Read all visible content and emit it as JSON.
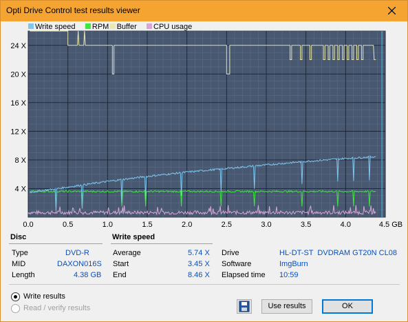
{
  "window": {
    "title": "Opti Drive Control test results viewer"
  },
  "legend": [
    {
      "label": "Write speed",
      "color": "#7ec8f0"
    },
    {
      "label": "RPM",
      "color": "#3ee63e"
    },
    {
      "label": "Buffer",
      "color": "#e8e8b0"
    },
    {
      "label": "CPU usage",
      "color": "#d7a6d7"
    }
  ],
  "chart_data": {
    "type": "line",
    "y_ticks": [
      "24 X",
      "20 X",
      "16 X",
      "12 X",
      "8 X",
      "4 X"
    ],
    "x_ticks": [
      "0.0",
      "0.5",
      "1.0",
      "1.5",
      "2.0",
      "2.5",
      "3.0",
      "3.5",
      "4.0",
      "4.5 GB"
    ],
    "xlim": [
      0,
      4.5
    ],
    "ylim": [
      0,
      26
    ],
    "series": [
      {
        "name": "Write speed",
        "x": [
          0,
          0.5,
          1.0,
          1.5,
          2.0,
          2.5,
          3.0,
          3.5,
          4.0,
          4.38
        ],
        "values": [
          3.45,
          4.2,
          5.0,
          5.7,
          6.3,
          6.8,
          7.3,
          7.8,
          8.2,
          8.46
        ]
      },
      {
        "name": "RPM",
        "x": [
          0,
          4.38
        ],
        "values": [
          3.6,
          3.6
        ]
      },
      {
        "name": "Buffer",
        "x": [
          0,
          0.5,
          0.52,
          1.05,
          1.06,
          4.38,
          4.4
        ],
        "values": [
          26,
          26,
          24,
          24,
          24,
          24,
          22
        ]
      },
      {
        "name": "CPU usage",
        "x": [
          0,
          4.38
        ],
        "values": [
          0.5,
          0.5
        ]
      }
    ]
  },
  "disc": {
    "header": "Disc",
    "type_label": "Type",
    "type_value": "DVD-R",
    "mid_label": "MID",
    "mid_value": "DAXON016S",
    "length_label": "Length",
    "length_value": "4.38 GB"
  },
  "write_speed": {
    "header": "Write speed",
    "average_label": "Average",
    "average_value": "5.74 X",
    "start_label": "Start",
    "start_value": "3.45 X",
    "end_label": "End",
    "end_value": "8.46 X"
  },
  "drive": {
    "drive_label": "Drive",
    "drive_value": "HL-DT-ST  DVDRAM GT20N CL08",
    "software_label": "Software",
    "software_value": "ImgBurn",
    "elapsed_label": "Elapsed time",
    "elapsed_value": "10:59"
  },
  "options": {
    "write_results": "Write results",
    "read_verify_results": "Read / verify results"
  },
  "buttons": {
    "use_results": "Use results",
    "ok": "OK"
  }
}
